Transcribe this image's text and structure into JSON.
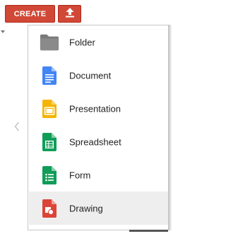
{
  "toolbar": {
    "create_label": "CREATE",
    "create_color": "#d14836",
    "upload_icon": "upload-icon"
  },
  "menu": {
    "items": [
      {
        "label": "Folder",
        "icon": "folder-icon",
        "color": "#7a7a7a"
      },
      {
        "label": "Document",
        "icon": "document-icon",
        "color": "#4285f4"
      },
      {
        "label": "Presentation",
        "icon": "presentation-icon",
        "color": "#f4b400"
      },
      {
        "label": "Spreadsheet",
        "icon": "spreadsheet-icon",
        "color": "#0f9d58"
      },
      {
        "label": "Form",
        "icon": "form-icon",
        "color": "#0f9d58"
      },
      {
        "label": "Drawing",
        "icon": "drawing-icon",
        "color": "#db4437"
      }
    ],
    "hovered_item": "Drawing"
  }
}
